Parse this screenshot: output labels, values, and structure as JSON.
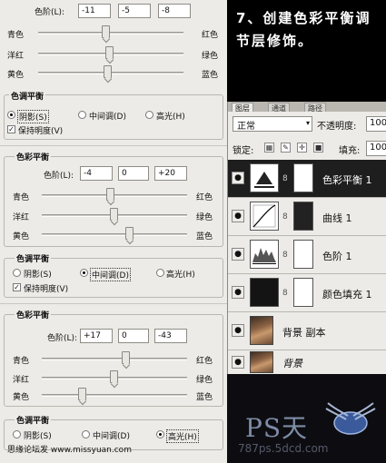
{
  "panel1": {
    "level_label": "色阶(L):",
    "levels": [
      "-11",
      "-5",
      "-8"
    ],
    "sliders": [
      {
        "left": "青色",
        "right": "红色",
        "value": -11
      },
      {
        "left": "洋红",
        "right": "绿色",
        "value": -5
      },
      {
        "left": "黄色",
        "right": "蓝色",
        "value": -8
      }
    ],
    "tone_title": "色调平衡",
    "tones": {
      "shadow": "阴影(S)",
      "mid": "中间调(D)",
      "high": "高光(H)"
    },
    "selected_tone": "shadow",
    "preserve": "保持明度(V)"
  },
  "panel2": {
    "title": "色彩平衡",
    "level_label": "色阶(L):",
    "levels": [
      "-4",
      "0",
      "+20"
    ],
    "sliders": [
      {
        "left": "青色",
        "right": "红色",
        "value": -4
      },
      {
        "left": "洋红",
        "right": "绿色",
        "value": 0
      },
      {
        "left": "黄色",
        "right": "蓝色",
        "value": 20
      }
    ],
    "tone_title": "色调平衡",
    "tones": {
      "shadow": "阴影(S)",
      "mid": "中间调(D)",
      "high": "高光(H)"
    },
    "selected_tone": "mid",
    "preserve": "保持明度(V)"
  },
  "panel3": {
    "title": "色彩平衡",
    "level_label": "色阶(L):",
    "levels": [
      "+17",
      "0",
      "-43"
    ],
    "sliders": [
      {
        "left": "青色",
        "right": "红色",
        "value": 17
      },
      {
        "left": "洋红",
        "right": "绿色",
        "value": 0
      },
      {
        "left": "黄色",
        "right": "蓝色",
        "value": -43
      }
    ],
    "tone_title": "色调平衡",
    "tones": {
      "shadow": "阴影(S)",
      "mid": "中间调(D)",
      "high": "高光(H)"
    },
    "selected_tone": "high"
  },
  "step_text": "7、创建色彩平衡调节层修饰。",
  "layers_panel": {
    "tabs": [
      "图层",
      "通道",
      "路径"
    ],
    "blend_mode": "正常",
    "opacity_label": "不透明度:",
    "opacity_value": "100",
    "lock_label": "锁定:",
    "fill_label": "填充:",
    "fill_value": "100",
    "layers": [
      {
        "name": "色彩平衡 1",
        "type": "color-balance",
        "selected": true
      },
      {
        "name": "曲线 1",
        "type": "curves",
        "selected": false
      },
      {
        "name": "色阶 1",
        "type": "levels",
        "selected": false
      },
      {
        "name": "颜色填充 1",
        "type": "fill",
        "selected": false
      },
      {
        "name": "背景 副本",
        "type": "photo",
        "selected": false
      },
      {
        "name": "背景",
        "type": "photo",
        "selected": false
      }
    ]
  },
  "watermark": {
    "logo": "PS天",
    "site": "787ps.5dcd.com"
  },
  "footer": "思缘论坛发 www.missyuan.com"
}
